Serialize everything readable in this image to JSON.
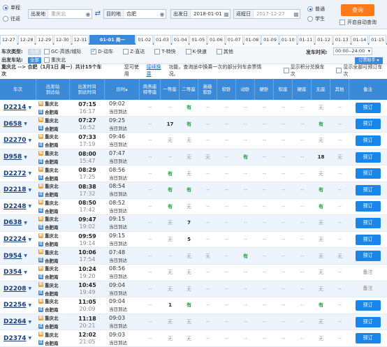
{
  "search": {
    "trip_single": "单程",
    "trip_round": "往返",
    "from_label": "出发地",
    "from_value": "重庆北",
    "to_label": "目的地",
    "to_value": "合肥",
    "date_label": "出发日",
    "date_value": "2018-01-01",
    "return_label": "返程日",
    "return_value": "2017-12-27",
    "type_normal": "普通",
    "type_student": "学生",
    "query_button": "查询",
    "auto_query": "开启自动查询"
  },
  "dates": [
    "12-27",
    "12-28",
    "12-29",
    "12-30",
    "12-31",
    "01-01 周一",
    "01-02",
    "01-03",
    "01-04",
    "01-05",
    "01-06",
    "01-07",
    "01-08",
    "01-09",
    "01-10",
    "01-11",
    "01-12",
    "01-13",
    "01-14",
    "01-15"
  ],
  "filter": {
    "type_label": "车次类型:",
    "all_tag": "全部",
    "options": [
      "GC-高铁/城际",
      "D-动车",
      "Z-直达",
      "T-特快",
      "K-快速",
      "其他"
    ],
    "depart_time_label": "发车时间:",
    "depart_time_value": "00:00--24:00",
    "station_label": "出发车站:",
    "station_value": "重庆北",
    "order_help": "订票助手"
  },
  "route": {
    "main": "重庆北 --> 合肥（1月1日 周一）共计15个车次",
    "notice_pre": "您可使用",
    "notice_link": "接续换乘",
    "notice_post": "功能，查询途中换乘一次的部分列车余票情况。",
    "opt_points": "显示积分兑换车次",
    "opt_all": "显示全部可预订车次"
  },
  "headers": {
    "train": "车次",
    "station_a": "出发站",
    "station_b": "到达站",
    "time_a": "出发时间",
    "time_b": "到达时间",
    "duration": "历时",
    "business": "商务座\n特等座",
    "first": "一等座",
    "second": "二等座",
    "adv_soft": "高级\n软卧",
    "soft_sleeper": "软卧",
    "moving_sleeper": "动卧",
    "hard_sleeper": "硬卧",
    "soft_seat": "软座",
    "hard_seat": "硬座",
    "no_seat": "无座",
    "other": "其他",
    "remark": "备注"
  },
  "trains": [
    {
      "no": "D2214",
      "from": "重庆北",
      "to": "合肥南",
      "dep": "07:15",
      "arr": "16:17",
      "dur": "09:02",
      "day": "当日到达",
      "seats": [
        "--",
        "--",
        "有",
        "--",
        "--",
        "--",
        "--",
        "--",
        "--",
        "无",
        "--"
      ],
      "book": "预订"
    },
    {
      "no": "D658",
      "from": "重庆北",
      "to": "合肥南",
      "dep": "07:27",
      "arr": "16:52",
      "dur": "09:25",
      "day": "当日到达",
      "seats": [
        "--",
        "17",
        "有",
        "--",
        "--",
        "--",
        "--",
        "--",
        "--",
        "有",
        "--"
      ],
      "book": "预订"
    },
    {
      "no": "D2270",
      "from": "重庆北",
      "to": "合肥南",
      "dep": "07:33",
      "arr": "17:19",
      "dur": "09:46",
      "day": "当日到达",
      "seats": [
        "--",
        "无",
        "无",
        "--",
        "--",
        "--",
        "--",
        "--",
        "--",
        "无",
        "--"
      ],
      "book": "预订"
    },
    {
      "no": "D958",
      "from": "重庆北",
      "to": "合肥南",
      "dep": "08:00",
      "arr": "15:47",
      "dur": "07:47",
      "day": "当日到达",
      "seats": [
        "--",
        "--",
        "无",
        "无",
        "--",
        "有",
        "--",
        "--",
        "--",
        "18",
        "无"
      ],
      "book": "预订"
    },
    {
      "no": "D2272",
      "from": "重庆北",
      "to": "合肥南",
      "dep": "08:29",
      "arr": "17:25",
      "dur": "08:56",
      "day": "当日到达",
      "seats": [
        "--",
        "有",
        "无",
        "--",
        "--",
        "--",
        "--",
        "--",
        "--",
        "无",
        "--"
      ],
      "book": "预订"
    },
    {
      "no": "D2218",
      "from": "重庆北",
      "to": "合肥南",
      "dep": "08:38",
      "arr": "17:32",
      "dur": "08:54",
      "day": "当日到达",
      "seats": [
        "--",
        "有",
        "有",
        "--",
        "--",
        "--",
        "--",
        "--",
        "--",
        "有",
        "--"
      ],
      "book": "预订"
    },
    {
      "no": "D2248",
      "from": "重庆北",
      "to": "合肥南",
      "dep": "08:50",
      "arr": "17:42",
      "dur": "08:52",
      "day": "当日到达",
      "seats": [
        "--",
        "有",
        "无",
        "--",
        "--",
        "--",
        "--",
        "--",
        "--",
        "有",
        "--"
      ],
      "book": "预订"
    },
    {
      "no": "D638",
      "from": "重庆北",
      "to": "合肥南",
      "dep": "09:47",
      "arr": "19:02",
      "dur": "09:15",
      "day": "当日到达",
      "seats": [
        "--",
        "无",
        "7",
        "--",
        "--",
        "--",
        "--",
        "--",
        "--",
        "无",
        "--"
      ],
      "book": "预订"
    },
    {
      "no": "D2224",
      "from": "重庆北",
      "to": "合肥南",
      "dep": "09:59",
      "arr": "19:14",
      "dur": "09:15",
      "day": "当日到达",
      "seats": [
        "--",
        "无",
        "5",
        "--",
        "--",
        "--",
        "--",
        "--",
        "--",
        "无",
        "--"
      ],
      "book": "预订"
    },
    {
      "no": "D954",
      "from": "重庆北",
      "to": "合肥南",
      "dep": "10:06",
      "arr": "17:54",
      "dur": "07:48",
      "day": "当日到达",
      "seats": [
        "--",
        "--",
        "无",
        "无",
        "--",
        "有",
        "--",
        "--",
        "--",
        "无",
        "无"
      ],
      "book": "预订"
    },
    {
      "no": "D354",
      "from": "重庆北",
      "to": "合肥南",
      "dep": "10:24",
      "arr": "19:20",
      "dur": "08:56",
      "day": "当日到达",
      "seats": [
        "--",
        "无",
        "无",
        "--",
        "--",
        "--",
        "--",
        "--",
        "--",
        "无",
        "--"
      ],
      "book": "备注"
    },
    {
      "no": "D2208",
      "from": "重庆北",
      "to": "合肥南",
      "dep": "10:45",
      "arr": "19:49",
      "dur": "09:04",
      "day": "当日到达",
      "seats": [
        "--",
        "无",
        "无",
        "--",
        "--",
        "--",
        "--",
        "--",
        "--",
        "无",
        "--"
      ],
      "book": "备注"
    },
    {
      "no": "D2256",
      "from": "重庆北",
      "to": "合肥南",
      "dep": "11:05",
      "arr": "20:09",
      "dur": "09:04",
      "day": "当日到达",
      "seats": [
        "--",
        "1",
        "有",
        "--",
        "--",
        "--",
        "--",
        "--",
        "--",
        "有",
        "--"
      ],
      "book": "预订"
    },
    {
      "no": "D2264",
      "from": "重庆北",
      "to": "合肥南",
      "dep": "11:18",
      "arr": "20:21",
      "dur": "09:03",
      "day": "当日到达",
      "seats": [
        "--",
        "无",
        "无",
        "--",
        "--",
        "--",
        "--",
        "--",
        "--",
        "无",
        "--"
      ],
      "book": "预订"
    },
    {
      "no": "D2374",
      "from": "重庆北",
      "to": "合肥南",
      "dep": "12:02",
      "arr": "21:05",
      "dur": "09:03",
      "day": "当日到达",
      "seats": [
        "--",
        "无",
        "无",
        "--",
        "--",
        "--",
        "--",
        "--",
        "--",
        "无",
        "--"
      ],
      "book": "预订"
    }
  ],
  "colors": {
    "accent": "#3b8ad8",
    "orange": "#ff7a1a",
    "green": "#1ca13d",
    "navy": "#1a3e7a"
  }
}
